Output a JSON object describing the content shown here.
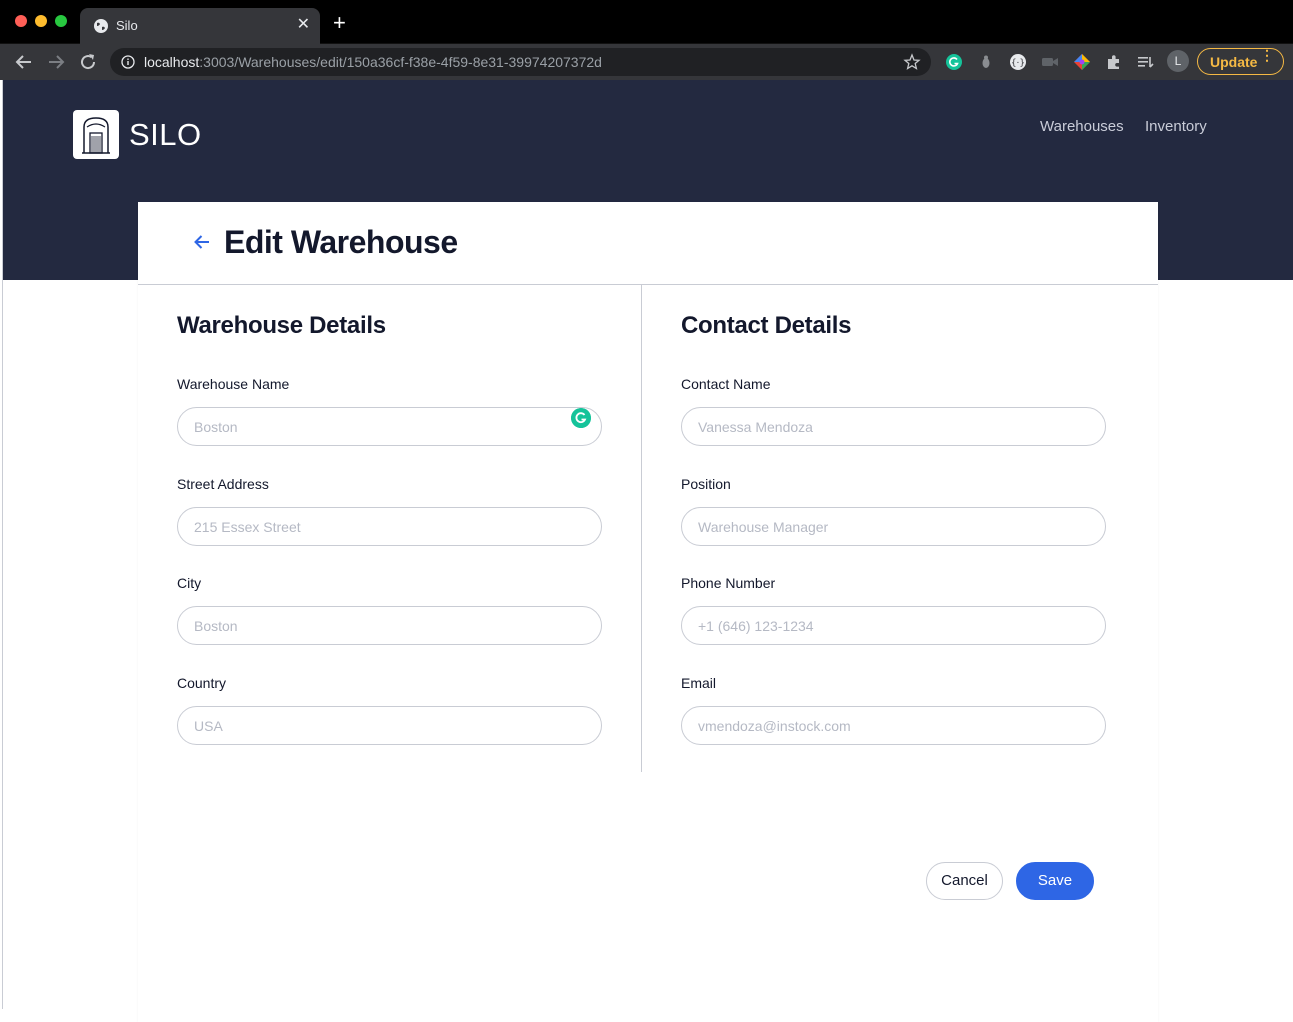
{
  "browser": {
    "tab_title": "Silo",
    "tab_close": "✕",
    "new_tab": "+",
    "url_host": "localhost",
    "url_path": ":3003/Warehouses/edit/150a36cf-f38e-4f59-8e31-39974207372d",
    "avatar_initial": "L",
    "update_label": "Update",
    "update_menu": "⋮"
  },
  "header": {
    "logo_text": "SILO",
    "nav": [
      "Warehouses",
      "Inventory"
    ]
  },
  "page": {
    "title": "Edit Warehouse"
  },
  "warehouse_details": {
    "title": "Warehouse Details",
    "fields": [
      {
        "label": "Warehouse Name",
        "placeholder": "Boston"
      },
      {
        "label": "Street Address",
        "placeholder": "215 Essex Street"
      },
      {
        "label": "City",
        "placeholder": "Boston"
      },
      {
        "label": "Country",
        "placeholder": "USA"
      }
    ]
  },
  "contact_details": {
    "title": "Contact Details",
    "fields": [
      {
        "label": "Contact Name",
        "placeholder": "Vanessa Mendoza"
      },
      {
        "label": "Position",
        "placeholder": "Warehouse Manager"
      },
      {
        "label": "Phone Number",
        "placeholder": "+1 (646) 123-1234"
      },
      {
        "label": "Email",
        "placeholder": "vmendoza@instock.com"
      }
    ]
  },
  "actions": {
    "cancel": "Cancel",
    "save": "Save"
  },
  "colors": {
    "header_bg": "#232940",
    "primary": "#2e66e5",
    "text_dark": "#13182c",
    "border": "#c9ccd4",
    "grammarly": "#15c39a",
    "update": "#f5b944"
  },
  "icons": {
    "back": "arrow-left-icon",
    "logo": "silo-building-icon",
    "grammarly": "grammarly-icon"
  }
}
